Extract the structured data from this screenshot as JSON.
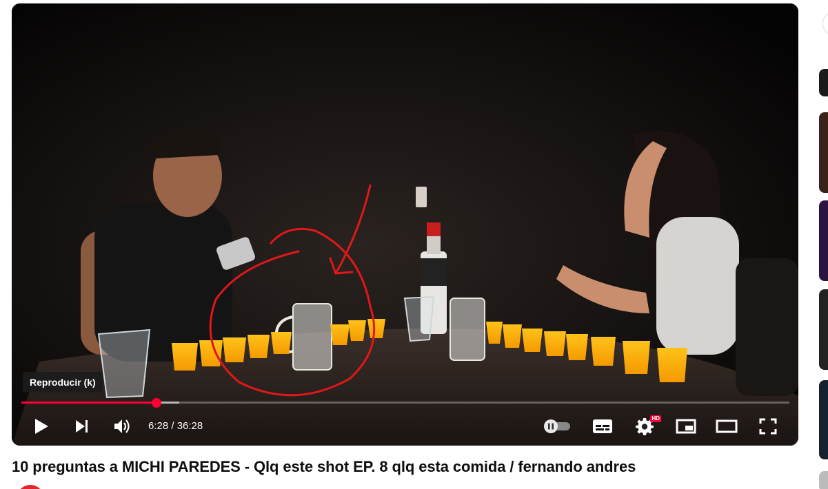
{
  "player": {
    "tooltip": "Reproducir (k)",
    "time_display": "6:28 / 36:28",
    "hd_badge": "HD",
    "progress_played_fraction": 0.176,
    "progress_buffered_fraction": 0.206
  },
  "icons": {
    "play": "play-icon",
    "next": "next-icon",
    "volume": "volume-icon",
    "autoplay": "autoplay-toggle-icon",
    "subtitles": "subtitles-icon",
    "settings": "gear-icon",
    "miniplayer": "miniplayer-icon",
    "theater": "theater-mode-icon",
    "fullscreen": "fullscreen-icon"
  },
  "colors": {
    "accent": "#ff0033",
    "player_bg": "#0b0908",
    "annotation": "#e01818"
  },
  "video": {
    "title": "10 preguntas a MICHI PAREDES - Qlq este shot EP. 8 qlq esta comida / fernando andres"
  }
}
